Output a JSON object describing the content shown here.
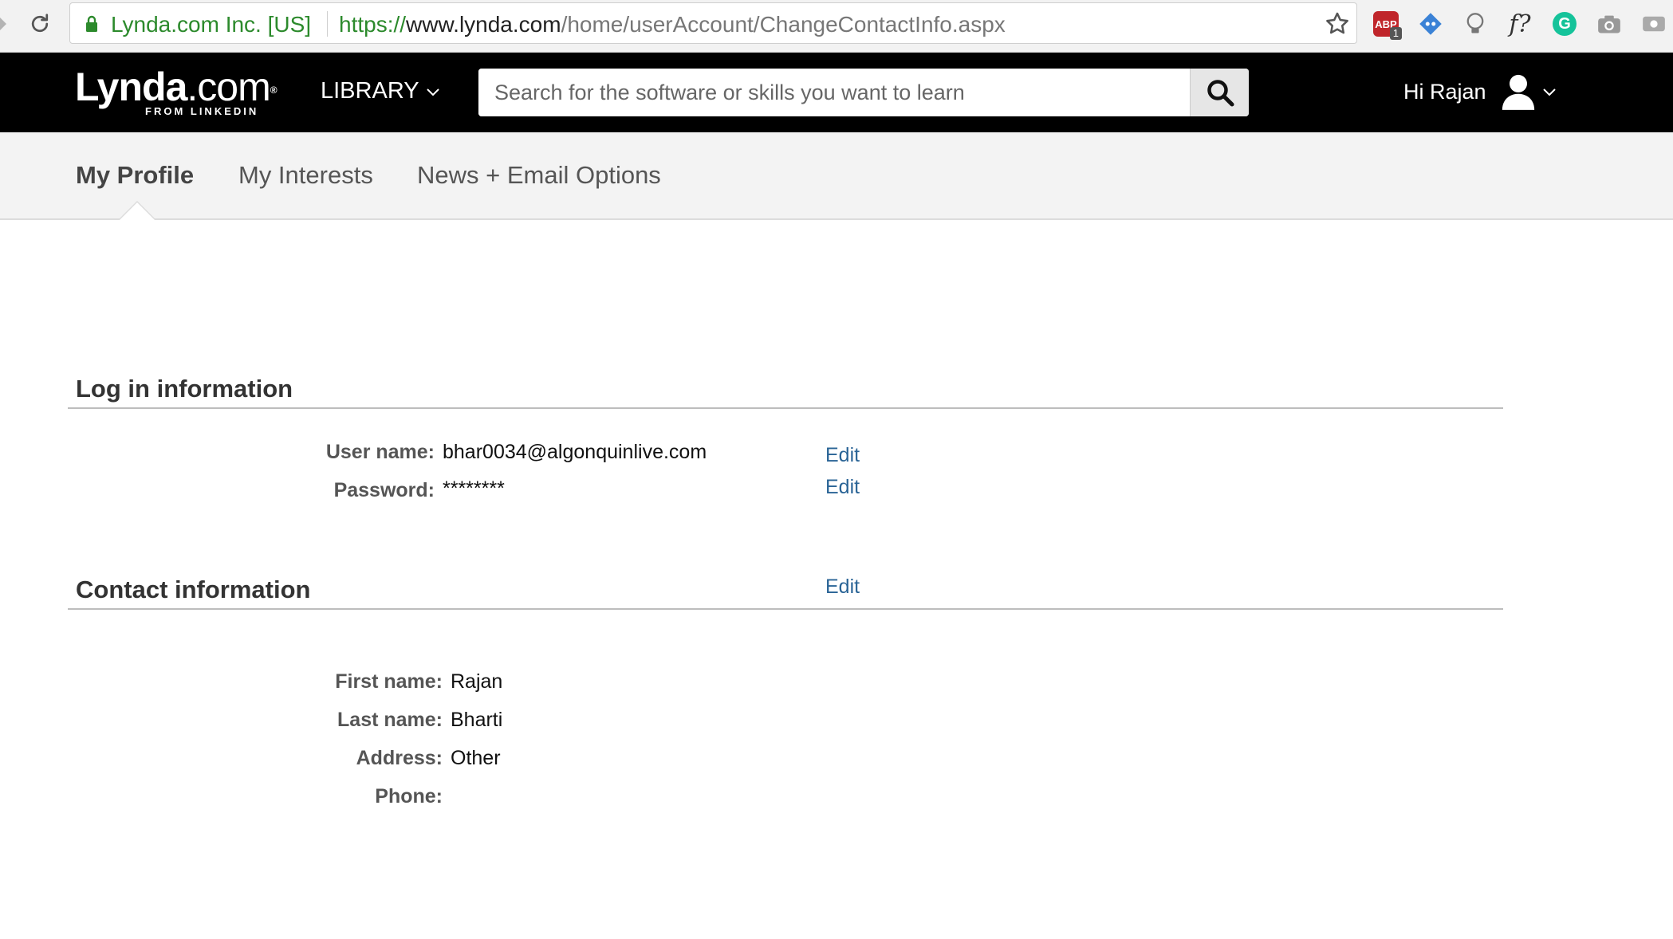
{
  "browser": {
    "site_identity": "Lynda.com Inc. [US]",
    "url_protocol": "https://",
    "url_host": "www.lynda.com",
    "url_path": "/home/userAccount/ChangeContactInfo.aspx",
    "extensions": [
      {
        "name": "adblock-plus",
        "label": "ABP",
        "badge": "1"
      },
      {
        "name": "web-developer",
        "label": ""
      },
      {
        "name": "lightbulb",
        "label": ""
      },
      {
        "name": "font-identifier",
        "label": "f?"
      },
      {
        "name": "grammarly",
        "label": "G"
      },
      {
        "name": "screenshot",
        "label": ""
      },
      {
        "name": "screencast",
        "label": ""
      }
    ]
  },
  "header": {
    "logo_main": "Lynda",
    "logo_dotcom": ".com",
    "logo_reg": "®",
    "logo_sub": "FROM LINKEDIN",
    "library_label": "LIBRARY",
    "search_placeholder": "Search for the software or skills you want to learn",
    "greeting": "Hi Rajan"
  },
  "tabs": [
    {
      "label": "My Profile",
      "active": true
    },
    {
      "label": "My Interests",
      "active": false
    },
    {
      "label": "News + Email Options",
      "active": false
    }
  ],
  "login_section": {
    "title": "Log in information",
    "username_label": "User name:",
    "username_value": "bhar0034@algonquinlive.com",
    "password_label": "Password:",
    "password_value": "********",
    "edit_label": "Edit"
  },
  "contact_section": {
    "title": "Contact information",
    "edit_label": "Edit",
    "first_name_label": "First name:",
    "first_name_value": "Rajan",
    "last_name_label": "Last name:",
    "last_name_value": "Bharti",
    "address_label": "Address:",
    "address_value": "Other",
    "phone_label": "Phone:",
    "phone_value": ""
  },
  "colors": {
    "header_bg": "#000000",
    "link": "#2a6496",
    "secure_green": "#2c8a2c"
  }
}
